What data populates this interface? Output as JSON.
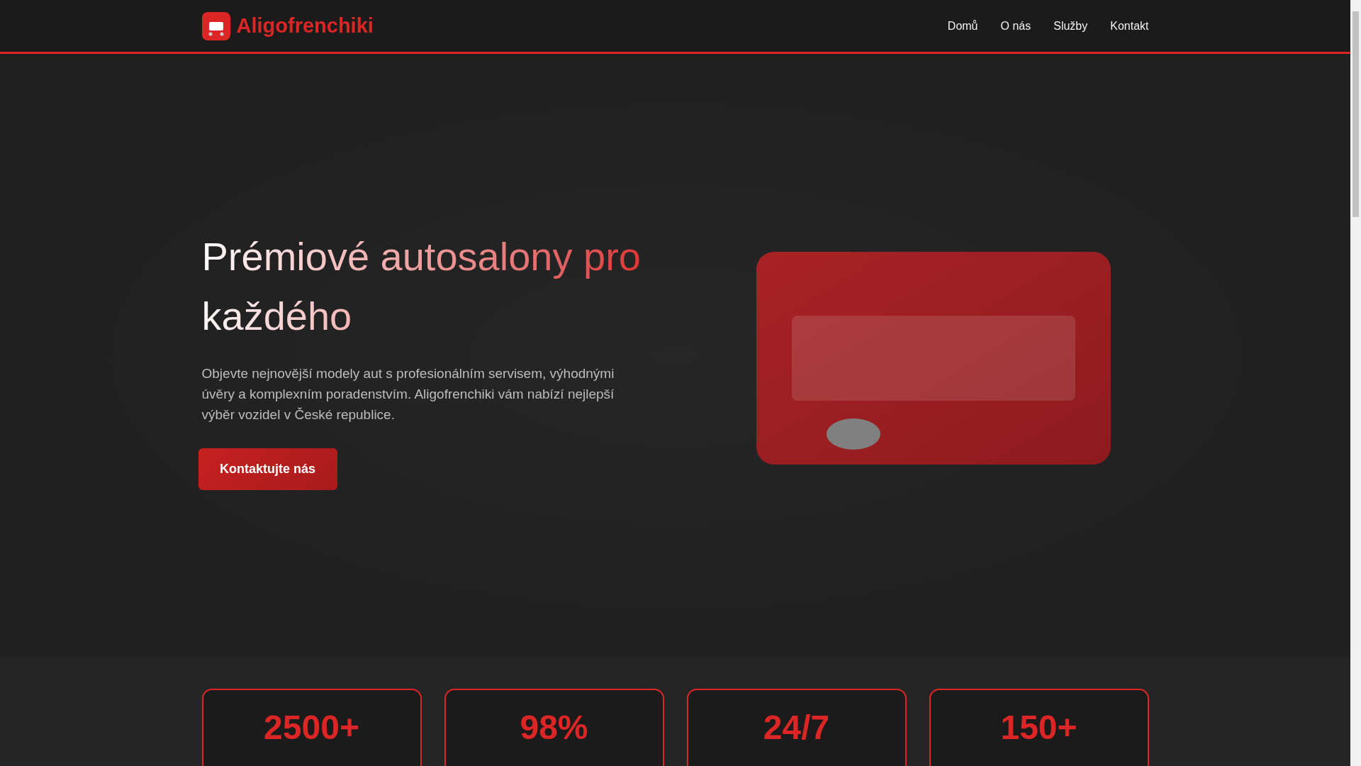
{
  "header": {
    "brand": "Aligofrenchiki",
    "nav": [
      {
        "label": "Domů"
      },
      {
        "label": "O nás"
      },
      {
        "label": "Služby"
      },
      {
        "label": "Kontakt"
      }
    ]
  },
  "hero": {
    "title": "Prémiové autosalony pro každého",
    "text": "Objevte nejnovější modely aut s profesionálním servisem, výhodnými úvěry a komplexním poradenstvím. Aligofrenchiki vám nabízí nejlepší výběr vozidel v České republice.",
    "button": "Kontaktujte nás"
  },
  "stats": [
    {
      "value": "2500+"
    },
    {
      "value": "98%"
    },
    {
      "value": "24/7"
    },
    {
      "value": "150+"
    }
  ]
}
